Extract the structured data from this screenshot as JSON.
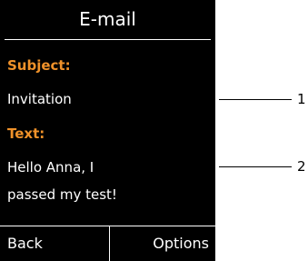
{
  "screen": {
    "title": "E-mail",
    "subject_label": "Subject:",
    "subject_value": "Invitation",
    "text_label": "Text:",
    "text_lines": [
      "Hello Anna, I",
      "passed my test!"
    ]
  },
  "softkeys": {
    "left": "Back",
    "right": "Options"
  },
  "callouts": [
    {
      "number": "1"
    },
    {
      "number": "2"
    }
  ],
  "colors": {
    "screen_background": "#000000",
    "label_accent": "#f0922a",
    "text": "#ffffff"
  }
}
